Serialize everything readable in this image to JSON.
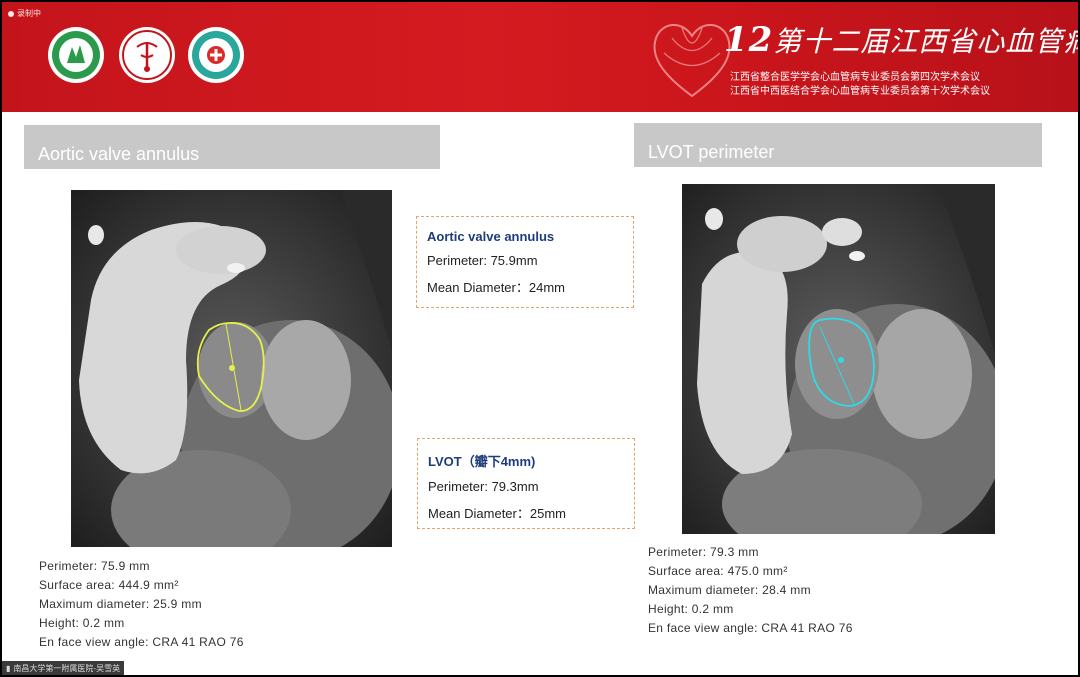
{
  "recording": {
    "label": "录制中"
  },
  "banner": {
    "forum_number": "12",
    "forum_title": "第十二届江西省心血管病高峰论坛",
    "subtitle_1": "江西省整合医学学会心血管病专业委员会第四次学术会议",
    "subtitle_2": "江西省中西医结合学会心血管病专业委员会第十次学术会议",
    "brand_color": "#d41b20"
  },
  "left_section": {
    "title": "Aortic valve annulus"
  },
  "right_section": {
    "title": "LVOT perimeter"
  },
  "box_annulus": {
    "title": "Aortic valve annulus",
    "perimeter": "Perimeter: 75.9mm",
    "mean_diameter": "Mean Diameter：24mm"
  },
  "box_lvot": {
    "title": "LVOT（瓣下4mm)",
    "perimeter": "Perimeter: 79.3mm",
    "mean_diameter": "Mean Diameter：25mm"
  },
  "left_measurements": {
    "perimeter": "Perimeter: 75.9 mm",
    "surface_area": "Surface area: 444.9 mm²",
    "max_diameter": "Maximum diameter: 25.9 mm",
    "height": "Height: 0.2 mm",
    "angle": "En face view angle: CRA  41 RAO  76"
  },
  "right_measurements": {
    "perimeter": "Perimeter: 79.3 mm",
    "surface_area": "Surface area: 475.0 mm²",
    "max_diameter": "Maximum diameter: 28.4 mm",
    "height": "Height: 0.2 mm",
    "angle": "En face view angle: CRA  41 RAO  76"
  },
  "footer": {
    "presenter": "南昌大学第一附属医院-吴雪英"
  },
  "colors": {
    "annulus_contour": "#e6f04a",
    "lvot_contour": "#2fd9e8",
    "box_border": "#e2a66a",
    "box_title": "#1f3c7a"
  }
}
